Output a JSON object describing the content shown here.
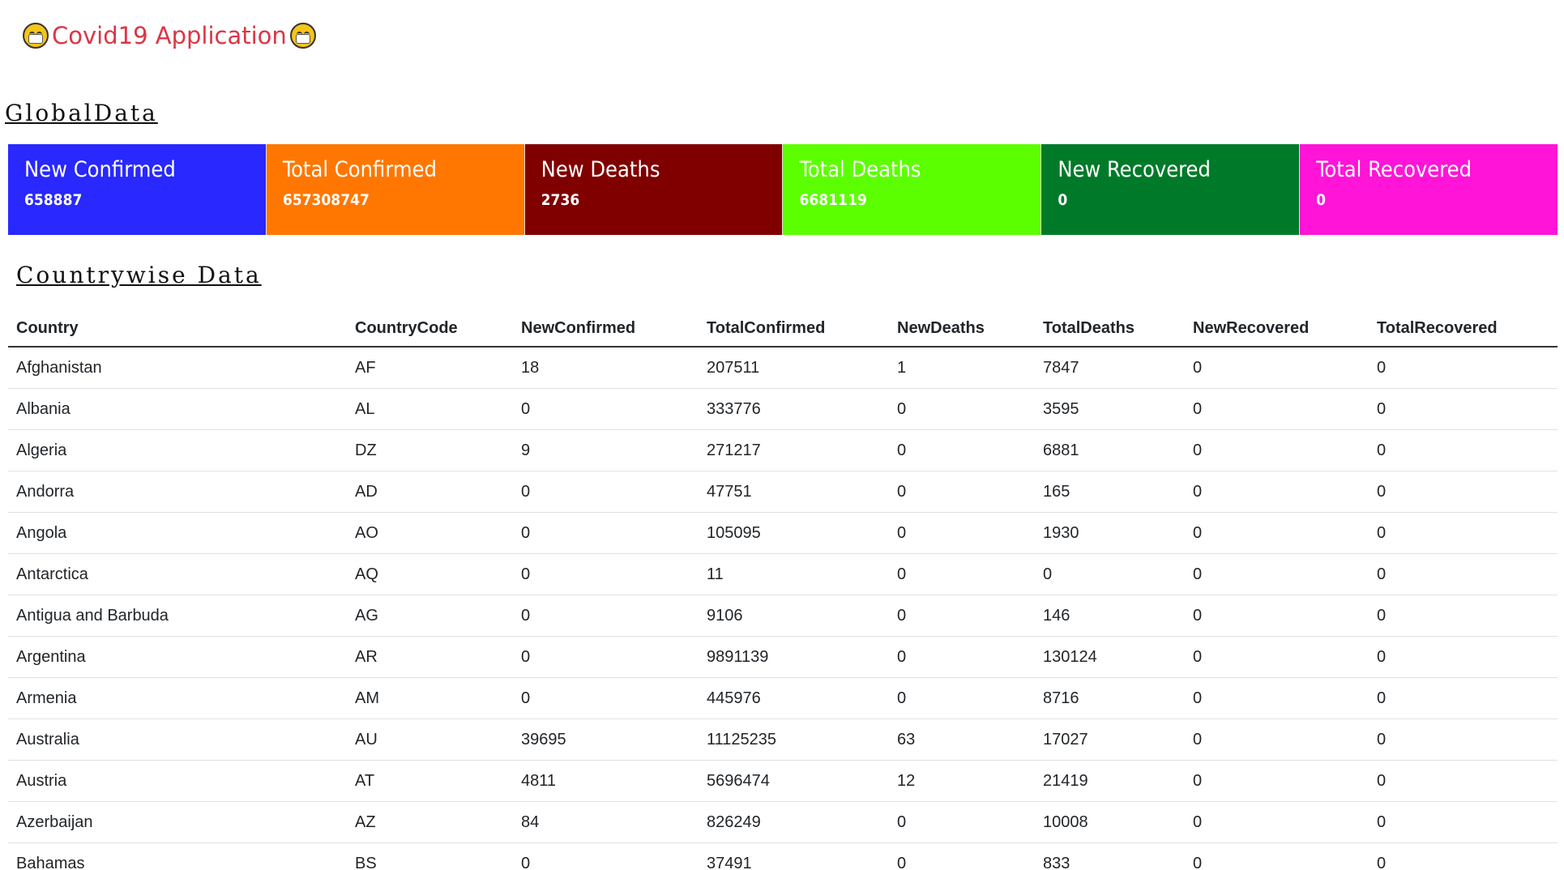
{
  "app": {
    "title": "Covid19 Application",
    "emoji": "face-with-medical-mask"
  },
  "global": {
    "heading": "GlobalData",
    "cards": [
      {
        "title": "New Confirmed",
        "value": "658887",
        "color": "#2828ff"
      },
      {
        "title": "Total Confirmed",
        "value": "657308747",
        "color": "#ff7700"
      },
      {
        "title": "New Deaths",
        "value": "2736",
        "color": "#800000"
      },
      {
        "title": "Total Deaths",
        "value": "6681119",
        "color": "#5cff00"
      },
      {
        "title": "New Recovered",
        "value": "0",
        "color": "#007a29"
      },
      {
        "title": "Total Recovered",
        "value": "0",
        "color": "#ff14d8"
      }
    ]
  },
  "countries": {
    "heading": "Countrywise Data",
    "columns": [
      "Country",
      "CountryCode",
      "NewConfirmed",
      "TotalConfirmed",
      "NewDeaths",
      "TotalDeaths",
      "NewRecovered",
      "TotalRecovered"
    ],
    "rows": [
      [
        "Afghanistan",
        "AF",
        "18",
        "207511",
        "1",
        "7847",
        "0",
        "0"
      ],
      [
        "Albania",
        "AL",
        "0",
        "333776",
        "0",
        "3595",
        "0",
        "0"
      ],
      [
        "Algeria",
        "DZ",
        "9",
        "271217",
        "0",
        "6881",
        "0",
        "0"
      ],
      [
        "Andorra",
        "AD",
        "0",
        "47751",
        "0",
        "165",
        "0",
        "0"
      ],
      [
        "Angola",
        "AO",
        "0",
        "105095",
        "0",
        "1930",
        "0",
        "0"
      ],
      [
        "Antarctica",
        "AQ",
        "0",
        "11",
        "0",
        "0",
        "0",
        "0"
      ],
      [
        "Antigua and Barbuda",
        "AG",
        "0",
        "9106",
        "0",
        "146",
        "0",
        "0"
      ],
      [
        "Argentina",
        "AR",
        "0",
        "9891139",
        "0",
        "130124",
        "0",
        "0"
      ],
      [
        "Armenia",
        "AM",
        "0",
        "445976",
        "0",
        "8716",
        "0",
        "0"
      ],
      [
        "Australia",
        "AU",
        "39695",
        "11125235",
        "63",
        "17027",
        "0",
        "0"
      ],
      [
        "Austria",
        "AT",
        "4811",
        "5696474",
        "12",
        "21419",
        "0",
        "0"
      ],
      [
        "Azerbaijan",
        "AZ",
        "84",
        "826249",
        "0",
        "10008",
        "0",
        "0"
      ],
      [
        "Bahamas",
        "BS",
        "0",
        "37491",
        "0",
        "833",
        "0",
        "0"
      ]
    ]
  }
}
